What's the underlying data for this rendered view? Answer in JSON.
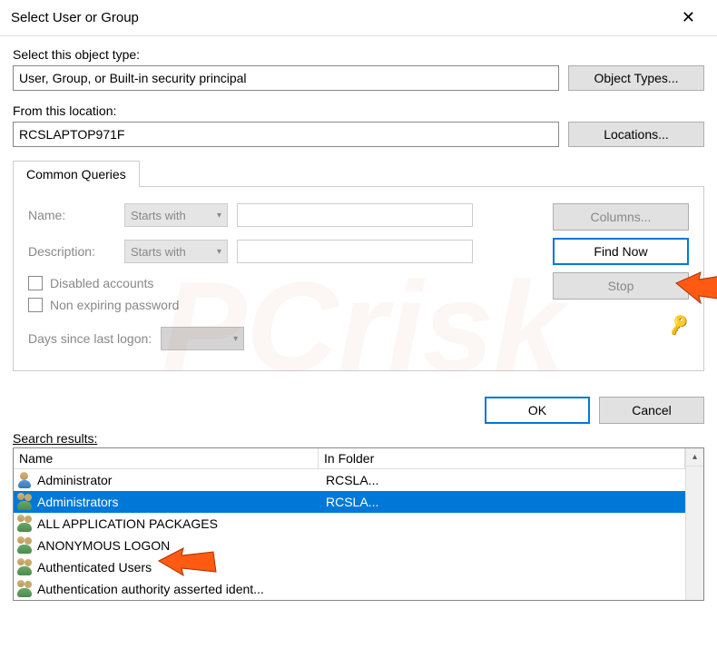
{
  "titlebar": {
    "title": "Select User or Group"
  },
  "objectType": {
    "label": "Select this object type:",
    "value": "User, Group, or Built-in security principal",
    "button": "Object Types..."
  },
  "location": {
    "label": "From this location:",
    "value": "RCSLAPTOP971F",
    "button": "Locations..."
  },
  "queries": {
    "tabLabel": "Common Queries",
    "nameLabel": "Name:",
    "nameMode": "Starts with",
    "descLabel": "Description:",
    "descMode": "Starts with",
    "disabledLabel": "Disabled accounts",
    "nonExpLabel": "Non expiring password",
    "daysLabel": "Days since last logon:",
    "columnsBtn": "Columns...",
    "findNowBtn": "Find Now",
    "stopBtn": "Stop"
  },
  "dialog": {
    "ok": "OK",
    "cancel": "Cancel"
  },
  "results": {
    "label": "Search results:",
    "colName": "Name",
    "colFolder": "In Folder",
    "rows": [
      {
        "icon": "user",
        "name": "Administrator",
        "folder": "RCSLA...",
        "selected": false
      },
      {
        "icon": "group",
        "name": "Administrators",
        "folder": "RCSLA...",
        "selected": true
      },
      {
        "icon": "group",
        "name": "ALL APPLICATION PACKAGES",
        "folder": "",
        "selected": false
      },
      {
        "icon": "group",
        "name": "ANONYMOUS LOGON",
        "folder": "",
        "selected": false
      },
      {
        "icon": "group",
        "name": "Authenticated Users",
        "folder": "",
        "selected": false
      },
      {
        "icon": "group",
        "name": "Authentication authority asserted ident...",
        "folder": "",
        "selected": false
      }
    ]
  }
}
